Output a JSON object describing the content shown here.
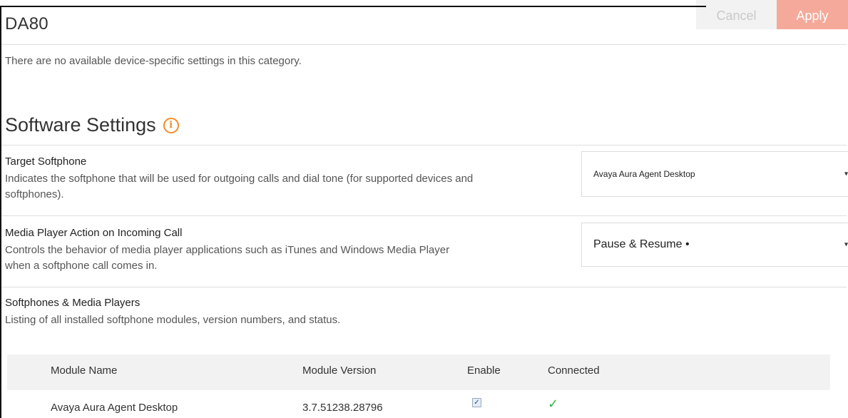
{
  "header": {
    "device_title": "DA80",
    "cancel_label": "Cancel",
    "apply_label": "Apply"
  },
  "device_category": {
    "message": "There are no available device-specific settings in this category."
  },
  "software_settings": {
    "title": "Software Settings",
    "info_icon": "info-icon",
    "target_softphone": {
      "label": "Target Softphone",
      "description": "Indicates the softphone that will be used for outgoing calls and dial tone (for supported devices and softphones).",
      "selected": "Avaya Aura Agent Desktop"
    },
    "media_player_action": {
      "label": "Media Player Action on Incoming Call",
      "description": "Controls the behavior of media player applications such as iTunes and Windows Media Player when a softphone call comes in.",
      "selected": "Pause & Resume •"
    },
    "softphones_media_players": {
      "label": "Softphones & Media Players",
      "description": "Listing of all installed softphone modules, version numbers, and status.",
      "columns": [
        "Module Name",
        "Module Version",
        "Enable",
        "Connected"
      ],
      "rows": [
        {
          "module_name": "Avaya Aura Agent Desktop",
          "module_version": "3.7.51238.28796",
          "enabled": true,
          "connected": true
        }
      ]
    }
  },
  "colors": {
    "accent_orange": "#f28c28",
    "apply_button": "#f5a99a",
    "connected_green": "#2eb84b"
  }
}
